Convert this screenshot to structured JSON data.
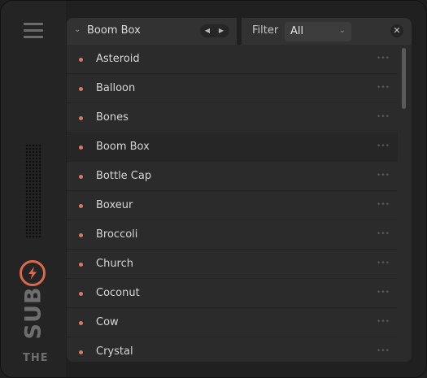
{
  "sidebar": {
    "logo_word": "SUB",
    "logo_prefix": "THE",
    "accent_color": "#d8694f"
  },
  "preset": {
    "name": "Boom Box",
    "prev_glyph": "◀",
    "next_glyph": "▶"
  },
  "filter": {
    "label": "Filter",
    "value": "All"
  },
  "list": {
    "selected": "Boom Box",
    "more_glyph": "•••",
    "dot_color": "#e0775c",
    "items": [
      {
        "label": "Asteroid"
      },
      {
        "label": "Balloon"
      },
      {
        "label": "Bones"
      },
      {
        "label": "Boom Box"
      },
      {
        "label": "Bottle Cap"
      },
      {
        "label": "Boxeur"
      },
      {
        "label": "Broccoli"
      },
      {
        "label": "Church"
      },
      {
        "label": "Coconut"
      },
      {
        "label": "Cow"
      },
      {
        "label": "Crystal"
      }
    ]
  }
}
